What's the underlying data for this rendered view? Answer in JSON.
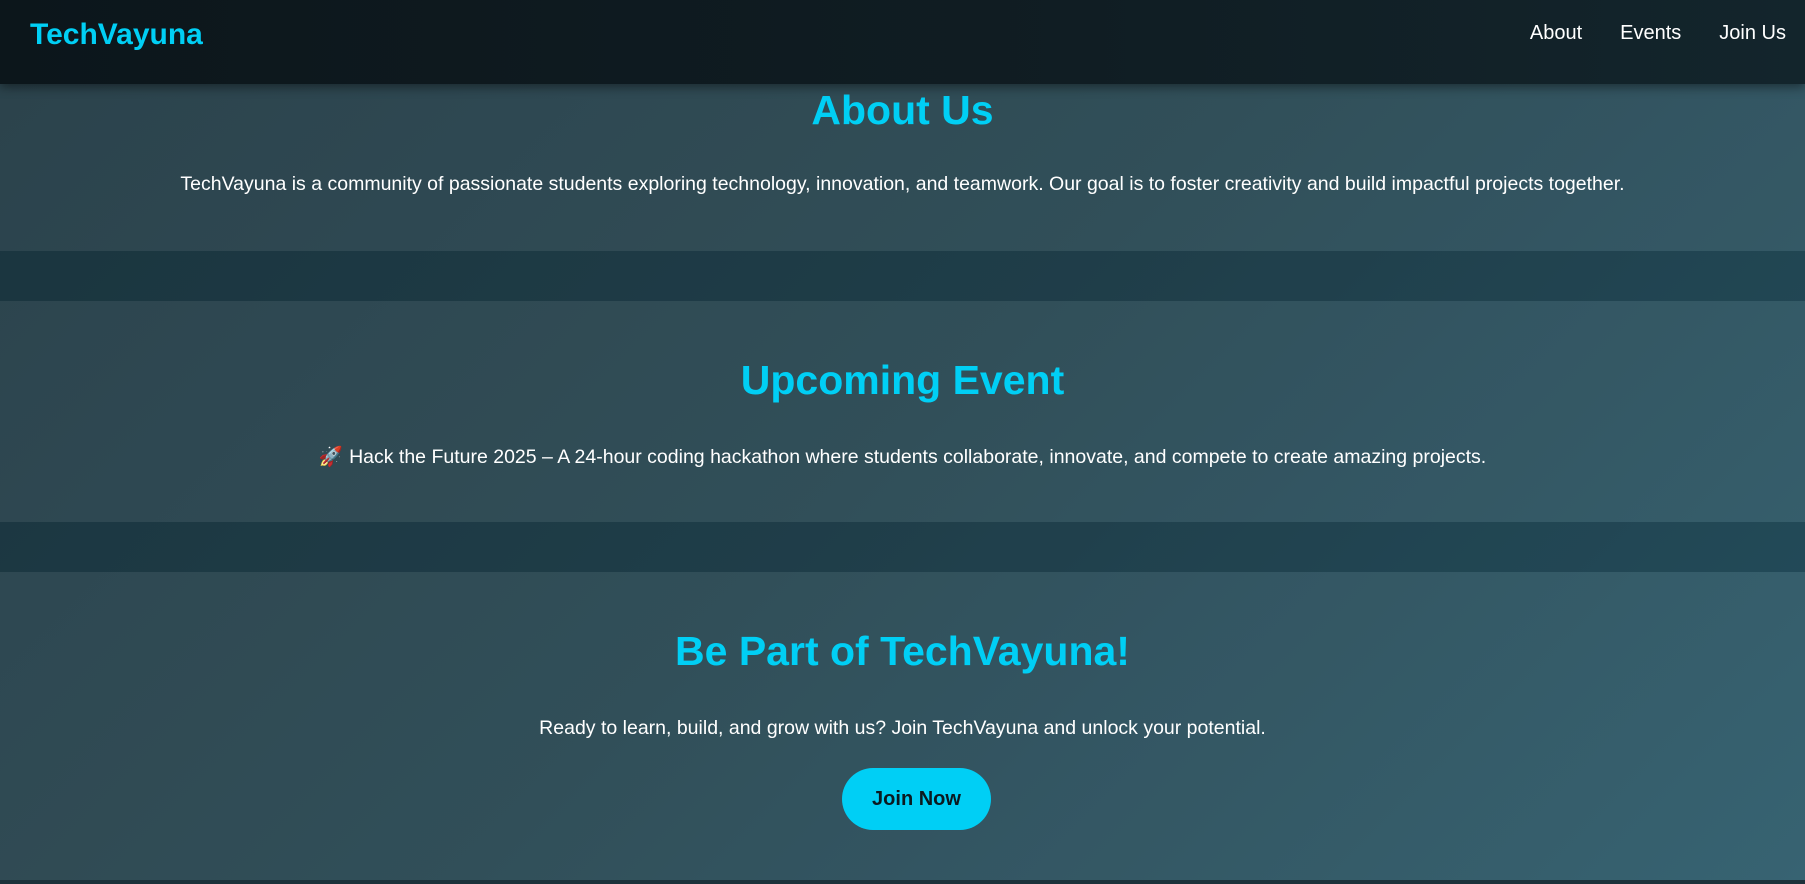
{
  "navbar": {
    "logo": "TechVayuna",
    "links": [
      {
        "label": "About"
      },
      {
        "label": "Events"
      },
      {
        "label": "Join Us"
      }
    ]
  },
  "about": {
    "title": "About Us",
    "text": "TechVayuna is a community of passionate students exploring technology, innovation, and teamwork. Our goal is to foster creativity and build impactful projects together."
  },
  "event": {
    "title": "Upcoming Event",
    "icon": "rocket-icon",
    "text": "Hack the Future 2025 – A 24-hour coding hackathon where students collaborate, innovate, and compete to create amazing projects."
  },
  "join": {
    "title": "Be Part of TechVayuna!",
    "text": "Ready to learn, build, and grow with us? Join TechVayuna and unlock your potential.",
    "button_label": "Join Now"
  },
  "colors": {
    "accent": "#00cff5",
    "nav_background": "#0c161b",
    "page_background": "#264550"
  }
}
